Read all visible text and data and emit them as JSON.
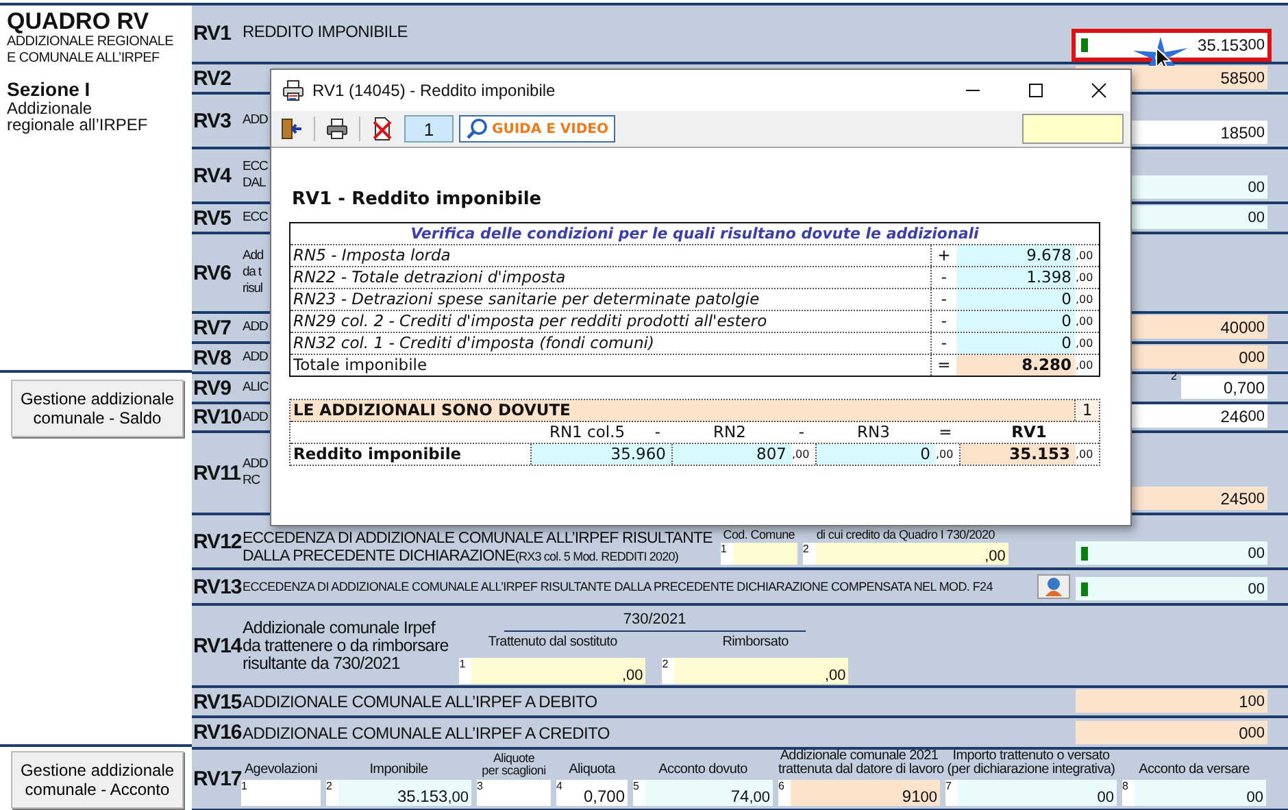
{
  "sidebar": {
    "title": "QUADRO RV",
    "subtitle": [
      "ADDIZIONALE REGIONALE",
      "E COMUNALE ALL’IRPEF"
    ],
    "section": "Sezione I",
    "section_desc": [
      "Addizionale",
      "regionale all’IRPEF"
    ],
    "buttons": [
      "Gestione addizionale comunale - Saldo",
      "Gestione addizionale comunale - Acconto"
    ]
  },
  "rows": [
    {
      "code": "RV1",
      "kind": "basic",
      "label": [
        "REDDITO IMPONIBILE"
      ],
      "value": {
        "amount": "35.153",
        "cents": "00",
        "color": "#ffffff",
        "flag": true,
        "highlight": true
      }
    },
    {
      "code": "RV2",
      "kind": "basic",
      "value": {
        "amount": "585",
        "cents": "00",
        "color": "#fde3cc"
      }
    },
    {
      "code": "RV3",
      "kind": "covered",
      "label": [
        "ADD"
      ],
      "value": {
        "amount": "185",
        "cents": "00",
        "color": "#ffffff"
      }
    },
    {
      "code": "RV4",
      "kind": "covered",
      "label": [
        "ECC",
        "DAL"
      ],
      "value": {
        "cents": "00",
        "color": "#e9fbfb"
      }
    },
    {
      "code": "RV5",
      "kind": "covered",
      "label": [
        "ECC"
      ],
      "value": {
        "cents": "00",
        "color": "#e9fbfb"
      }
    },
    {
      "code": "RV6",
      "kind": "covered",
      "label": [
        "Add",
        "da t",
        "risul"
      ]
    },
    {
      "code": "RV7",
      "kind": "covered",
      "label": [
        "ADD"
      ],
      "value": {
        "amount": "400",
        "cents": "00",
        "color": "#fde3cc"
      }
    },
    {
      "code": "RV8",
      "kind": "covered",
      "label": [
        "ADD"
      ],
      "value": {
        "amount": "0",
        "cents": "00",
        "color": "#fde3cc"
      }
    },
    {
      "code": "RV9",
      "kind": "covered",
      "label": [
        "ALIC"
      ],
      "value": {
        "num": "2",
        "amount": "0,700",
        "color": "#ffffff"
      }
    },
    {
      "code": "RV10",
      "kind": "covered",
      "label": [
        "ADD"
      ],
      "value": {
        "amount": "246",
        "cents": "00",
        "color": "#ffffff"
      }
    },
    {
      "code": "RV11",
      "kind": "covered",
      "label": [
        "ADD",
        "RC"
      ],
      "value": {
        "amount": "245",
        "cents": "00",
        "color": "#fde3cc"
      }
    },
    {
      "code": "RV12",
      "kind": "excess",
      "label": [
        "ECCEDENZA DI ADDIZIONALE COMUNALE ALL’IRPEF RISULTANTE",
        "DALLA PRECEDENTE DICHIARAZIONE"
      ],
      "note": "(RX3 col. 5 Mod. REDDITI 2020)",
      "fields": [
        {
          "caption": [
            "Cod. Comune"
          ],
          "num": "1",
          "color": "#fffbd0"
        },
        {
          "caption": [
            "di cui credito da Quadro I 730/2020"
          ],
          "num": "2",
          "cents": ",00",
          "color": "#fffbd0"
        }
      ],
      "value": {
        "cents": "00",
        "color": "#e9fbfb",
        "flag": true,
        "highlight": false
      }
    },
    {
      "code": "RV13",
      "kind": "f24",
      "label": [
        "ECCEDENZA DI ADDIZIONALE COMUNALE ALL’IRPEF RISULTANTE DALLA PRECEDENTE DICHIARAZIONE COMPENSATA NEL MOD. F24"
      ],
      "value": {
        "cents": "00",
        "color": "#e9fbfb",
        "flag": true,
        "highlight": false
      }
    },
    {
      "code": "RV14",
      "kind": "return730",
      "label": [
        "Addizionale comunale Irpef",
        "da trattenere o da rimborsare",
        "risultante da 730/2021"
      ],
      "header": "730/2021",
      "fields": [
        {
          "caption": [
            "Trattenuto dal sostituto"
          ],
          "num": "1",
          "cents": ",00",
          "color": "#fffbd0"
        },
        {
          "caption": [
            "Rimborsato"
          ],
          "num": "2",
          "cents": ",00",
          "color": "#fffbd0"
        }
      ]
    },
    {
      "code": "RV15",
      "kind": "basic",
      "label": [
        "ADDIZIONALE COMUNALE ALL’IRPEF A DEBITO"
      ],
      "value": {
        "amount": "1",
        "cents": "00",
        "color": "#fde3cc"
      }
    },
    {
      "code": "RV16",
      "kind": "basic",
      "label": [
        "ADDIZIONALE COMUNALE ALL’IRPEF A CREDITO"
      ],
      "value": {
        "amount": "0",
        "cents": "00",
        "color": "#fde3cc"
      }
    },
    {
      "code": "RV17",
      "kind": "acconto",
      "fields": [
        {
          "caption": [
            "Agevolazioni"
          ],
          "num": "1",
          "color": "#ffffff"
        },
        {
          "caption": [
            "Imponibile"
          ],
          "num": "2",
          "amount": "35.153",
          "cents": ",00",
          "color": "#e9fbfb"
        },
        {
          "caption": [
            "Aliquote",
            "per scaglioni"
          ],
          "num": "3",
          "color": "#ffffff"
        },
        {
          "caption": [
            "Aliquota"
          ],
          "num": "4",
          "amount": "0,700",
          "color": "#ffffff"
        },
        {
          "caption": [
            "Acconto dovuto"
          ],
          "num": "5",
          "amount": "74",
          "cents": ",00",
          "color": "#e9fbfb"
        },
        {
          "caption": [
            "Addizionale comunale 2021",
            "trattenuta dal datore di lavoro"
          ],
          "num": "6",
          "amount": "91",
          "cents": "00",
          "color": "#fde3cc"
        },
        {
          "caption": [
            "Importo trattenuto o versato",
            "(per dichiarazione integrativa)"
          ],
          "num": "7",
          "cents": "00",
          "color": "#e9fbfb"
        },
        {
          "caption": [
            "Acconto da versare"
          ],
          "num": "8",
          "cents": "00",
          "color": "#e9fbfb"
        }
      ]
    }
  ],
  "dialog": {
    "title": "RV1 (14045) - Reddito imponibile",
    "page": "1",
    "guide_button": "GUIDA E VIDEO",
    "heading": "RV1 - Reddito imponibile",
    "table_title": "Verifica delle condizioni per le quali risultano dovute le addizionali",
    "items": [
      {
        "kind": "item",
        "label": "RN5 - Imposta lorda",
        "sign": "+",
        "amount": "9.678",
        "cents": ",00"
      },
      {
        "kind": "item",
        "label": "RN22 - Totale detrazioni d'imposta",
        "sign": "-",
        "amount": "1.398",
        "cents": ",00"
      },
      {
        "kind": "item",
        "label": "RN23 - Detrazioni spese sanitarie per determinate patolgie",
        "sign": "-",
        "amount": "0",
        "cents": ",00"
      },
      {
        "kind": "item",
        "label": "RN29 col. 2 - Crediti d'imposta per redditi prodotti all'estero",
        "sign": "-",
        "amount": "0",
        "cents": ",00"
      },
      {
        "kind": "item",
        "label": "RN32 col. 1 - Crediti d'imposta (fondi comuni)",
        "sign": "-",
        "amount": "0",
        "cents": ",00"
      },
      {
        "kind": "total",
        "label": "Totale imponibile",
        "sign": "=",
        "amount": "8.280",
        "cents": ",00"
      }
    ],
    "result": {
      "banner": "LE ADDIZIONALI SONO DOVUTE",
      "count": "1",
      "label": "Reddito imponibile",
      "columns": [
        {
          "name": "RN1 col.5",
          "op": "-",
          "amount": "35.960",
          "color": "#d6fafd"
        },
        {
          "name": "RN2",
          "op": "-",
          "amount": "807",
          "cents": ",00",
          "color": "#d6fafd"
        },
        {
          "name": "RN3",
          "op": "=",
          "amount": "0",
          "cents": ",00",
          "color": "#d6fafd"
        },
        {
          "name": "RV1",
          "amount": "35.153",
          "cents": ",00",
          "color": "#fde3cc"
        }
      ]
    }
  }
}
